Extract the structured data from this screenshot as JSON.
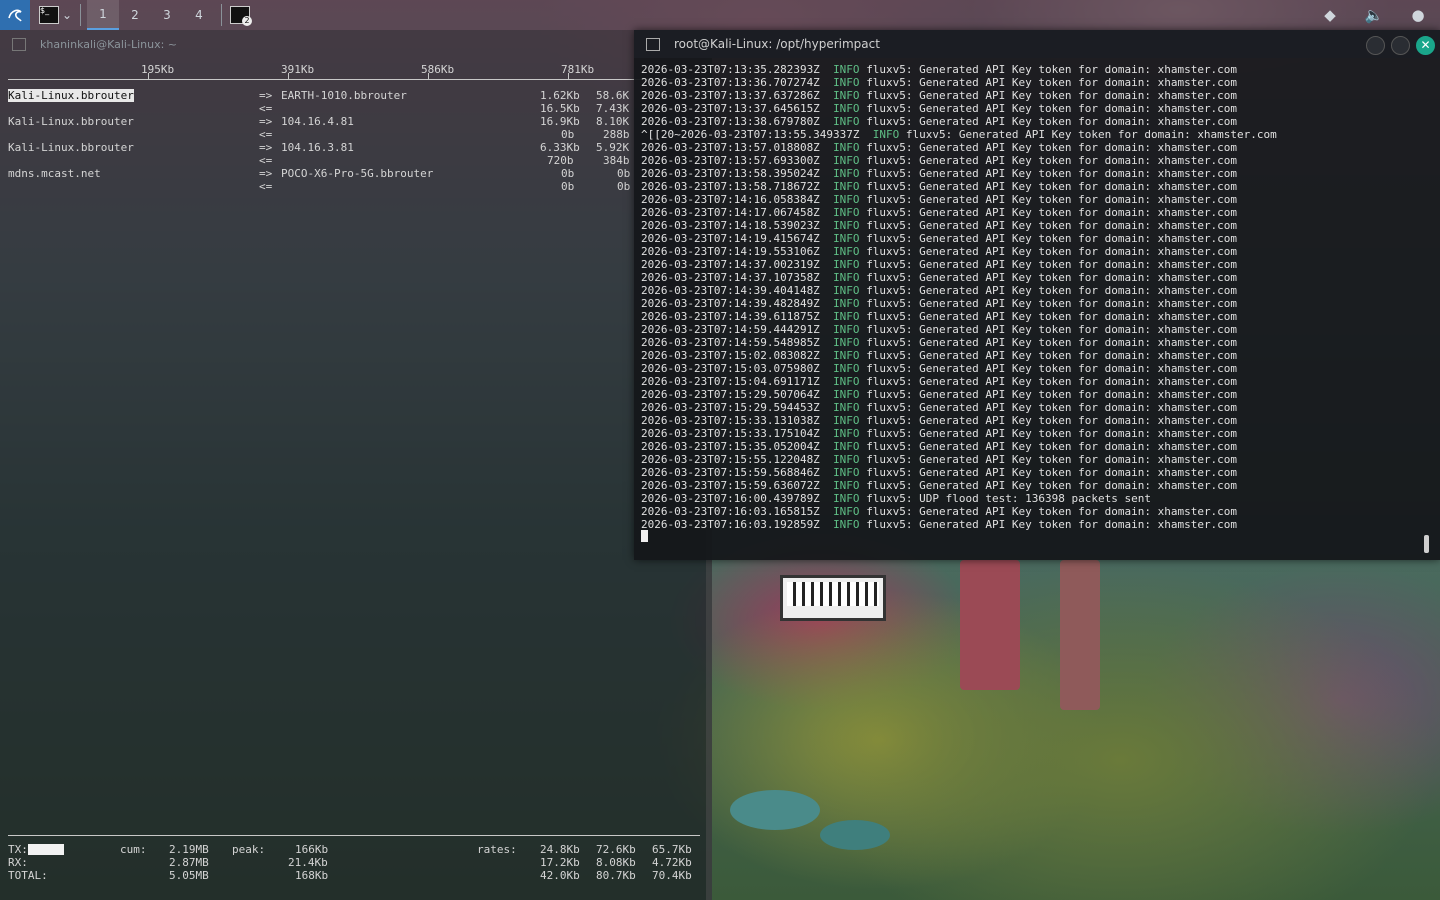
{
  "panel": {
    "workspaces": [
      "1",
      "2",
      "3",
      "4"
    ],
    "active_workspace": "1",
    "task_badge": "2",
    "icons": [
      "kali-dragon-icon",
      "terminal-icon",
      "chevron-down-icon",
      "terminal-icon",
      "network-icon",
      "volume-icon",
      "power-icon"
    ]
  },
  "left_window": {
    "title": "khaninkali@Kali-Linux: ~",
    "scale": [
      "195Kb",
      "391Kb",
      "586Kb",
      "781Kb"
    ],
    "flows": [
      {
        "src": "Kali-Linux.bbrouter",
        "dst": "EARTH-1010.bbrouter",
        "out": [
          "1.62Kb",
          "58.6K"
        ],
        "in": [
          "16.5Kb",
          "7.43K"
        ]
      },
      {
        "src": "Kali-Linux.bbrouter",
        "dst": "104.16.4.81",
        "out": [
          "16.9Kb",
          "8.10K"
        ],
        "in": [
          "0b",
          "288b"
        ]
      },
      {
        "src": "Kali-Linux.bbrouter",
        "dst": "104.16.3.81",
        "out": [
          "6.33Kb",
          "5.92K"
        ],
        "in": [
          "720b",
          "384b"
        ]
      },
      {
        "src": "mdns.mcast.net",
        "dst": "POCO-X6-Pro-5G.bbrouter",
        "out": [
          "0b",
          "0b"
        ],
        "in": [
          "0b",
          "0b"
        ]
      }
    ],
    "arrow_out": "=>",
    "arrow_in": "<=",
    "totals": {
      "labels": [
        "TX:",
        "RX:",
        "TOTAL:"
      ],
      "cum_label": "cum:",
      "peak_label": "peak:",
      "rates_label": "rates:",
      "cum": [
        "2.19MB",
        "2.87MB",
        "5.05MB"
      ],
      "peak": [
        "166Kb",
        "21.4Kb",
        "168Kb"
      ],
      "rates": [
        [
          "24.8Kb",
          "72.6Kb",
          "65.7Kb"
        ],
        [
          "17.2Kb",
          "8.08Kb",
          "4.72Kb"
        ],
        [
          "42.0Kb",
          "80.7Kb",
          "70.4Kb"
        ]
      ]
    }
  },
  "right_window": {
    "title": "root@Kali-Linux: /opt/hyperimpact",
    "close_glyph": "✕",
    "log": [
      {
        "ts": "2026-03-23T07:13:35.282393Z",
        "lvl": "INFO",
        "msg": "fluxv5: Generated API Key token for domain: xhamster.com"
      },
      {
        "ts": "2026-03-23T07:13:36.707274Z",
        "lvl": "INFO",
        "msg": "fluxv5: Generated API Key token for domain: xhamster.com"
      },
      {
        "ts": "2026-03-23T07:13:37.637286Z",
        "lvl": "INFO",
        "msg": "fluxv5: Generated API Key token for domain: xhamster.com"
      },
      {
        "ts": "2026-03-23T07:13:37.645615Z",
        "lvl": "INFO",
        "msg": "fluxv5: Generated API Key token for domain: xhamster.com"
      },
      {
        "ts": "2026-03-23T07:13:38.679780Z",
        "lvl": "INFO",
        "msg": "fluxv5: Generated API Key token for domain: xhamster.com"
      },
      {
        "ts": "^[[20~2026-03-23T07:13:55.349337Z",
        "lvl": "INFO",
        "msg": "fluxv5: Generated API Key token for domain: xhamster.com"
      },
      {
        "ts": "2026-03-23T07:13:57.018808Z",
        "lvl": "INFO",
        "msg": "fluxv5: Generated API Key token for domain: xhamster.com"
      },
      {
        "ts": "2026-03-23T07:13:57.693300Z",
        "lvl": "INFO",
        "msg": "fluxv5: Generated API Key token for domain: xhamster.com"
      },
      {
        "ts": "2026-03-23T07:13:58.395024Z",
        "lvl": "INFO",
        "msg": "fluxv5: Generated API Key token for domain: xhamster.com"
      },
      {
        "ts": "2026-03-23T07:13:58.718672Z",
        "lvl": "INFO",
        "msg": "fluxv5: Generated API Key token for domain: xhamster.com"
      },
      {
        "ts": "2026-03-23T07:14:16.058384Z",
        "lvl": "INFO",
        "msg": "fluxv5: Generated API Key token for domain: xhamster.com"
      },
      {
        "ts": "2026-03-23T07:14:17.067458Z",
        "lvl": "INFO",
        "msg": "fluxv5: Generated API Key token for domain: xhamster.com"
      },
      {
        "ts": "2026-03-23T07:14:18.539023Z",
        "lvl": "INFO",
        "msg": "fluxv5: Generated API Key token for domain: xhamster.com"
      },
      {
        "ts": "2026-03-23T07:14:19.415674Z",
        "lvl": "INFO",
        "msg": "fluxv5: Generated API Key token for domain: xhamster.com"
      },
      {
        "ts": "2026-03-23T07:14:19.553106Z",
        "lvl": "INFO",
        "msg": "fluxv5: Generated API Key token for domain: xhamster.com"
      },
      {
        "ts": "2026-03-23T07:14:37.002319Z",
        "lvl": "INFO",
        "msg": "fluxv5: Generated API Key token for domain: xhamster.com"
      },
      {
        "ts": "2026-03-23T07:14:37.107358Z",
        "lvl": "INFO",
        "msg": "fluxv5: Generated API Key token for domain: xhamster.com"
      },
      {
        "ts": "2026-03-23T07:14:39.404148Z",
        "lvl": "INFO",
        "msg": "fluxv5: Generated API Key token for domain: xhamster.com"
      },
      {
        "ts": "2026-03-23T07:14:39.482849Z",
        "lvl": "INFO",
        "msg": "fluxv5: Generated API Key token for domain: xhamster.com"
      },
      {
        "ts": "2026-03-23T07:14:39.611875Z",
        "lvl": "INFO",
        "msg": "fluxv5: Generated API Key token for domain: xhamster.com"
      },
      {
        "ts": "2026-03-23T07:14:59.444291Z",
        "lvl": "INFO",
        "msg": "fluxv5: Generated API Key token for domain: xhamster.com"
      },
      {
        "ts": "2026-03-23T07:14:59.548985Z",
        "lvl": "INFO",
        "msg": "fluxv5: Generated API Key token for domain: xhamster.com"
      },
      {
        "ts": "2026-03-23T07:15:02.083082Z",
        "lvl": "INFO",
        "msg": "fluxv5: Generated API Key token for domain: xhamster.com"
      },
      {
        "ts": "2026-03-23T07:15:03.075980Z",
        "lvl": "INFO",
        "msg": "fluxv5: Generated API Key token for domain: xhamster.com"
      },
      {
        "ts": "2026-03-23T07:15:04.691171Z",
        "lvl": "INFO",
        "msg": "fluxv5: Generated API Key token for domain: xhamster.com"
      },
      {
        "ts": "2026-03-23T07:15:29.507064Z",
        "lvl": "INFO",
        "msg": "fluxv5: Generated API Key token for domain: xhamster.com"
      },
      {
        "ts": "2026-03-23T07:15:29.594453Z",
        "lvl": "INFO",
        "msg": "fluxv5: Generated API Key token for domain: xhamster.com"
      },
      {
        "ts": "2026-03-23T07:15:33.131038Z",
        "lvl": "INFO",
        "msg": "fluxv5: Generated API Key token for domain: xhamster.com"
      },
      {
        "ts": "2026-03-23T07:15:33.175104Z",
        "lvl": "INFO",
        "msg": "fluxv5: Generated API Key token for domain: xhamster.com"
      },
      {
        "ts": "2026-03-23T07:15:35.052004Z",
        "lvl": "INFO",
        "msg": "fluxv5: Generated API Key token for domain: xhamster.com"
      },
      {
        "ts": "2026-03-23T07:15:55.122048Z",
        "lvl": "INFO",
        "msg": "fluxv5: Generated API Key token for domain: xhamster.com"
      },
      {
        "ts": "2026-03-23T07:15:59.568846Z",
        "lvl": "INFO",
        "msg": "fluxv5: Generated API Key token for domain: xhamster.com"
      },
      {
        "ts": "2026-03-23T07:15:59.636072Z",
        "lvl": "INFO",
        "msg": "fluxv5: Generated API Key token for domain: xhamster.com"
      },
      {
        "ts": "2026-03-23T07:16:00.439789Z",
        "lvl": "INFO",
        "msg": "fluxv5: UDP flood test: 136398 packets sent"
      },
      {
        "ts": "2026-03-23T07:16:03.165815Z",
        "lvl": "INFO",
        "msg": "fluxv5: Generated API Key token for domain: xhamster.com"
      },
      {
        "ts": "2026-03-23T07:16:03.192859Z",
        "lvl": "INFO",
        "msg": "fluxv5: Generated API Key token for domain: xhamster.com"
      }
    ]
  }
}
